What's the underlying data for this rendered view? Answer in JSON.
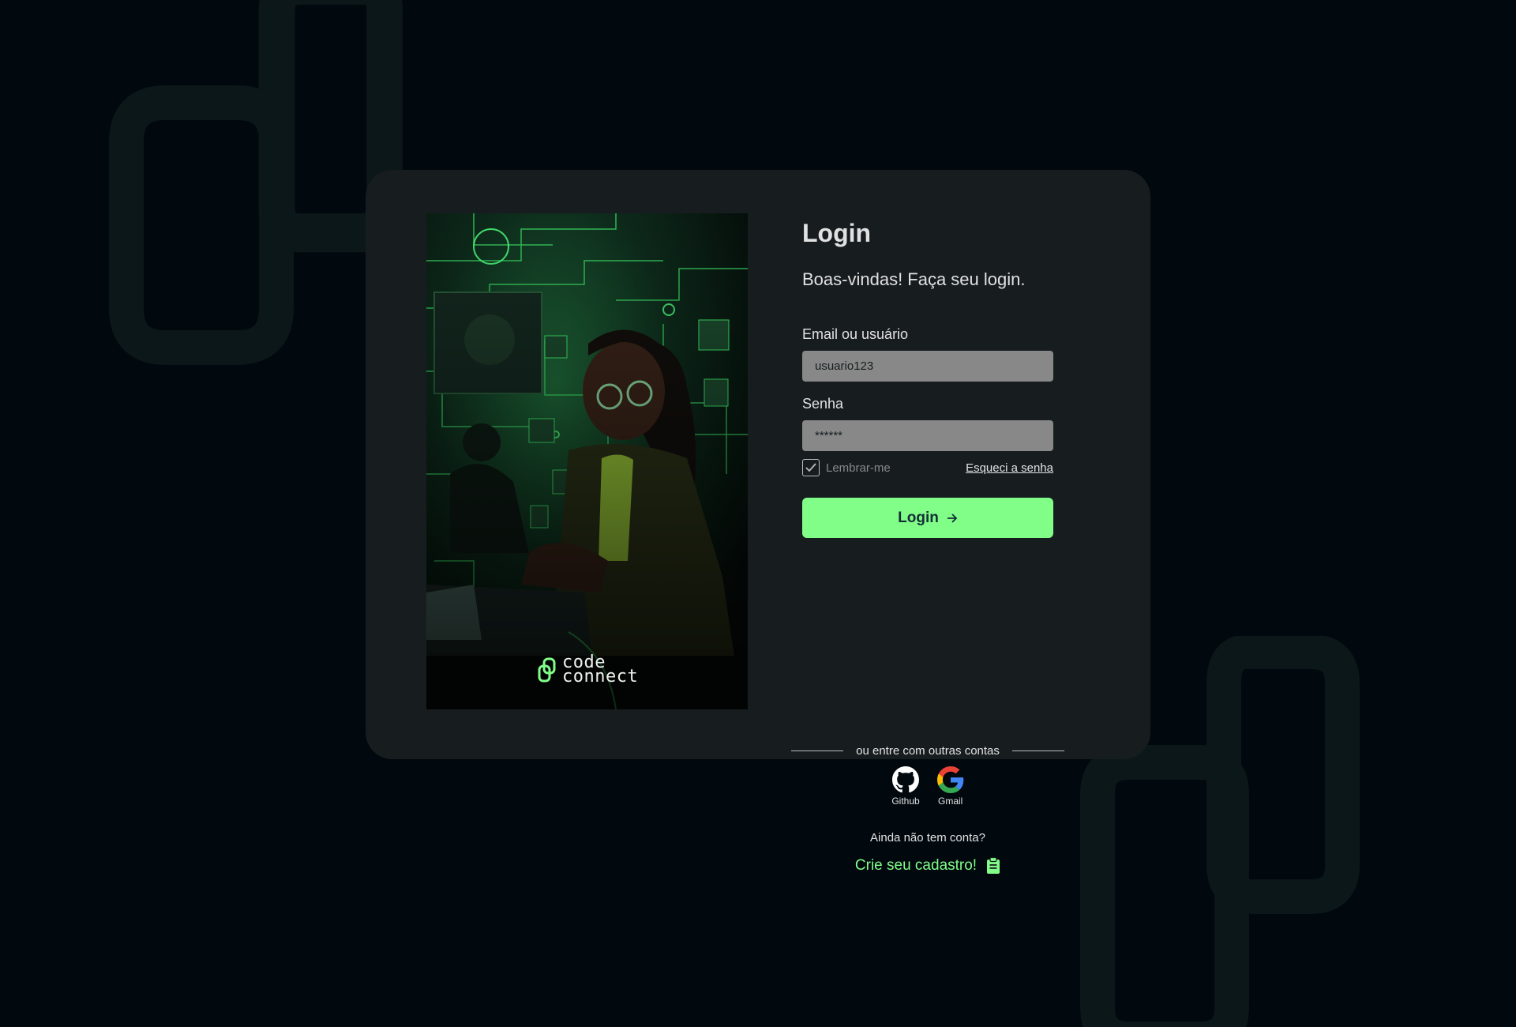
{
  "brand": {
    "line1": "code",
    "line2": "connect"
  },
  "login": {
    "title": "Login",
    "subtitle": "Boas-vindas! Faça seu login.",
    "email_label": "Email ou usuário",
    "email_value": "usuario123",
    "password_label": "Senha",
    "password_value": "******",
    "remember_label": "Lembrar-me",
    "remember_checked": true,
    "forgot_label": "Esqueci a senha",
    "button_label": "Login"
  },
  "social": {
    "divider_text": "ou entre com outras contas",
    "providers": [
      {
        "label": "Github",
        "icon": "github-icon"
      },
      {
        "label": "Gmail",
        "icon": "google-icon"
      }
    ]
  },
  "signup": {
    "question": "Ainda não tem conta?",
    "link_label": "Crie seu cadastro!",
    "icon": "clipboard-icon"
  },
  "colors": {
    "background": "#01080e",
    "card": "#171d1f",
    "accent": "#81fe88",
    "input": "#888888",
    "text": "#e1e1e1"
  }
}
